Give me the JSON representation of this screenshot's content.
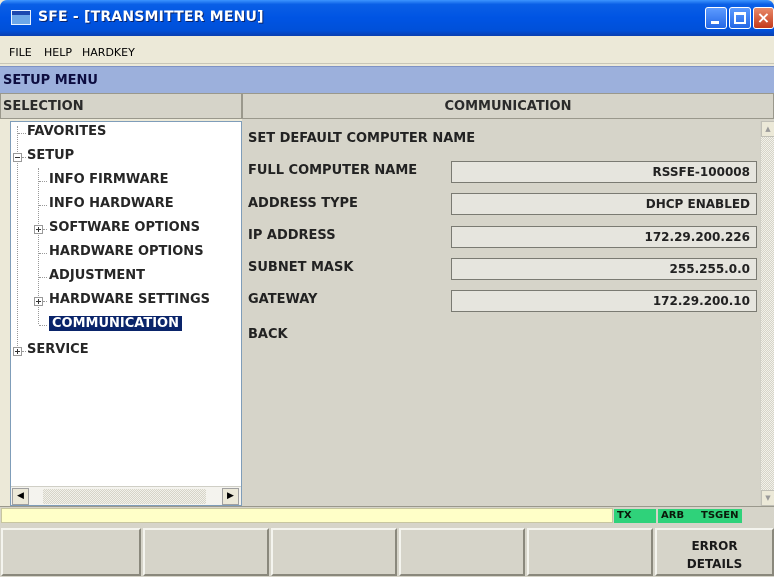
{
  "window": {
    "title": "SFE - [TRANSMITTER MENU]",
    "controls": {
      "minimize": "minimize",
      "maximize": "maximize",
      "close": "×"
    }
  },
  "menubar": {
    "items": [
      "FILE",
      "HELP",
      "HARDKEY"
    ]
  },
  "setup_menu": {
    "title": "SETUP MENU"
  },
  "selection": {
    "header": "SELECTION",
    "tree": [
      {
        "label": "FAVORITES",
        "level": 0,
        "expander": "none"
      },
      {
        "label": "SETUP",
        "level": 0,
        "expander": "minus"
      },
      {
        "label": "INFO FIRMWARE",
        "level": 1,
        "expander": "none"
      },
      {
        "label": "INFO HARDWARE",
        "level": 1,
        "expander": "none"
      },
      {
        "label": "SOFTWARE OPTIONS",
        "level": 1,
        "expander": "plus"
      },
      {
        "label": "HARDWARE OPTIONS",
        "level": 1,
        "expander": "none"
      },
      {
        "label": "ADJUSTMENT",
        "level": 1,
        "expander": "none"
      },
      {
        "label": "HARDWARE SETTINGS",
        "level": 1,
        "expander": "plus"
      },
      {
        "label": "COMMUNICATION",
        "level": 1,
        "expander": "none",
        "selected": true
      },
      {
        "label": "SERVICE",
        "level": 0,
        "expander": "plus"
      }
    ],
    "scroll_left": "◀",
    "scroll_right": "▶"
  },
  "communication": {
    "header": "COMMUNICATION",
    "set_default": "SET DEFAULT COMPUTER NAME",
    "fields": [
      {
        "label": "FULL COMPUTER NAME",
        "value": "RSSFE-100008"
      },
      {
        "label": "ADDRESS TYPE",
        "value": "DHCP ENABLED"
      },
      {
        "label": "IP ADDRESS",
        "value": "172.29.200.226"
      },
      {
        "label": "SUBNET MASK",
        "value": "255.255.0.0"
      },
      {
        "label": "GATEWAY",
        "value": "172.29.200.10"
      }
    ],
    "back": "BACK",
    "scroll_up": "▲",
    "scroll_down": "▼"
  },
  "status": {
    "message": "",
    "indicators": [
      "TX",
      "ARB",
      "TSGEN"
    ],
    "indicator_color": "#2fd27a"
  },
  "softkeys": [
    "",
    "",
    "",
    "",
    "",
    "ERROR\nDETAILS"
  ]
}
